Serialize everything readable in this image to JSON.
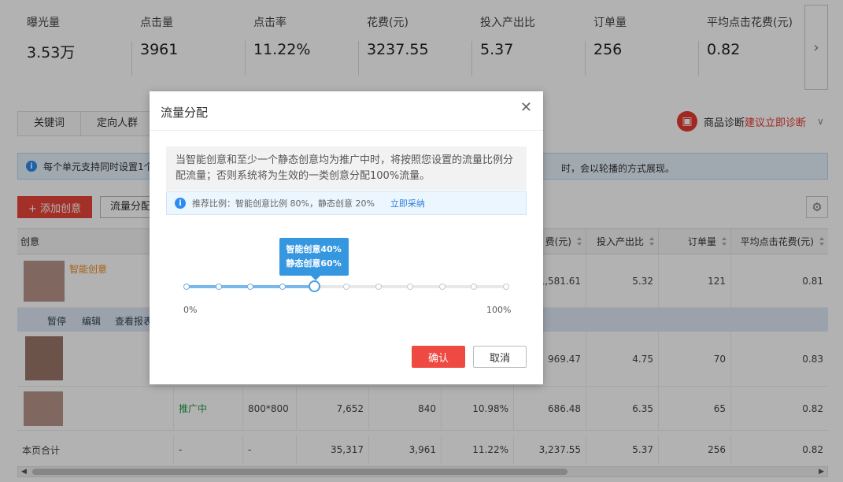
{
  "metrics": [
    {
      "label": "曝光量",
      "value": "3.53万"
    },
    {
      "label": "点击量",
      "value": "3961"
    },
    {
      "label": "点击率",
      "value": "11.22%"
    },
    {
      "label": "花费(元)",
      "value": "3237.55"
    },
    {
      "label": "投入产出比",
      "value": "5.37"
    },
    {
      "label": "订单量",
      "value": "256"
    },
    {
      "label": "平均点击花费(元)",
      "value": "0.82"
    }
  ],
  "metrics_next_icon": "chevron-right-icon",
  "tabs": [
    "关键词",
    "定向人群"
  ],
  "diagnosis": {
    "label": "商品诊断",
    "link": "建议立即诊断",
    "icon": "diagnosis-icon"
  },
  "notice": {
    "head": "每个单元支持同时设置1个",
    "tail": "时，会以轮播的方式展现。"
  },
  "actions": {
    "add_label": "+ 添加创意",
    "flow_label": "流量分配"
  },
  "table": {
    "headers": {
      "creative": "创意",
      "cost": "费(元)",
      "roi": "投入产出比",
      "orders": "订单量",
      "cpc": "平均点击花费(元)"
    },
    "creative_tag": "智能创意",
    "row_actions": [
      "暂停",
      "编辑",
      "查看报表"
    ],
    "rows": [
      {
        "cost": "1,581.61",
        "roi": "5.32",
        "orders": "121",
        "cpc": "0.81"
      },
      {
        "cost": "969.47",
        "roi": "4.75",
        "orders": "70",
        "cpc": "0.83"
      },
      {
        "status": "推广中",
        "size": "800*800",
        "impressions": "7,652",
        "clicks": "840",
        "ctr": "10.98%",
        "cost": "686.48",
        "roi": "6.35",
        "orders": "65",
        "cpc": "0.82"
      }
    ],
    "total": {
      "label": "本页合计",
      "status": "-",
      "size": "-",
      "impressions": "35,317",
      "clicks": "3,961",
      "ctr": "11.22%",
      "cost": "3,237.55",
      "roi": "5.37",
      "orders": "256",
      "cpc": "0.82"
    }
  },
  "dialog": {
    "title": "流量分配",
    "description": "当智能创意和至少一个静态创意均为推广中时，将按照您设置的流量比例分配流量；否则系统将为生效的一类创意分配100%流量。",
    "tip": "推荐比例：智能创意比例 80%，静态创意 20%",
    "tip_link": "立即采纳",
    "slider": {
      "smart_label": "智能创意40%",
      "static_label": "静态创意60%",
      "value_percent": 40,
      "steps": 10,
      "min_label": "0%",
      "max_label": "100%"
    },
    "confirm": "确认",
    "cancel": "取消"
  },
  "colors": {
    "accent_red": "#e8453c",
    "slider_blue": "#3497e0",
    "status_green": "#1f9b3a",
    "link_blue": "#2d7fd6"
  }
}
